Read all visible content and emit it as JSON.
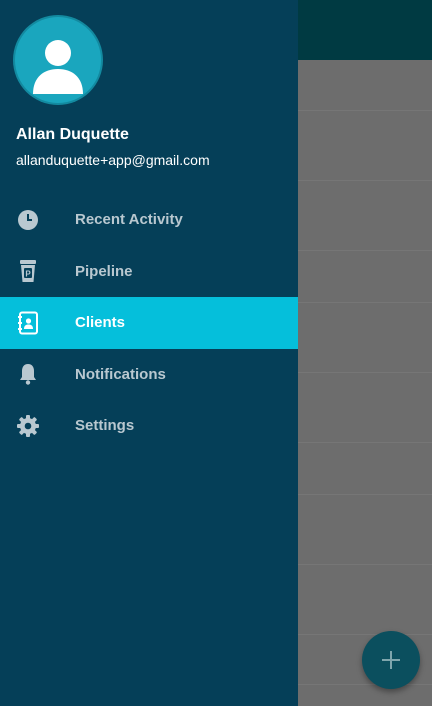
{
  "user": {
    "name": "Allan Duquette",
    "email": "allanduquette+app@gmail.com"
  },
  "menu": {
    "items": [
      {
        "label": "Recent Activity",
        "icon": "clock-icon",
        "active": false
      },
      {
        "label": "Pipeline",
        "icon": "pipeline-cup-icon",
        "active": false
      },
      {
        "label": "Clients",
        "icon": "contacts-book-icon",
        "active": true
      },
      {
        "label": "Notifications",
        "icon": "bell-icon",
        "active": false
      },
      {
        "label": "Settings",
        "icon": "gear-icon",
        "active": false
      }
    ]
  },
  "fab": {
    "icon": "plus-icon"
  },
  "colors": {
    "drawer_bg": "#053f58",
    "active_item_bg": "#05bfdb",
    "avatar_bg": "#1aa6be",
    "inactive_text": "#b9c8d0",
    "appbar_bg": "#003a42",
    "fab_bg": "#0b4f5e"
  }
}
